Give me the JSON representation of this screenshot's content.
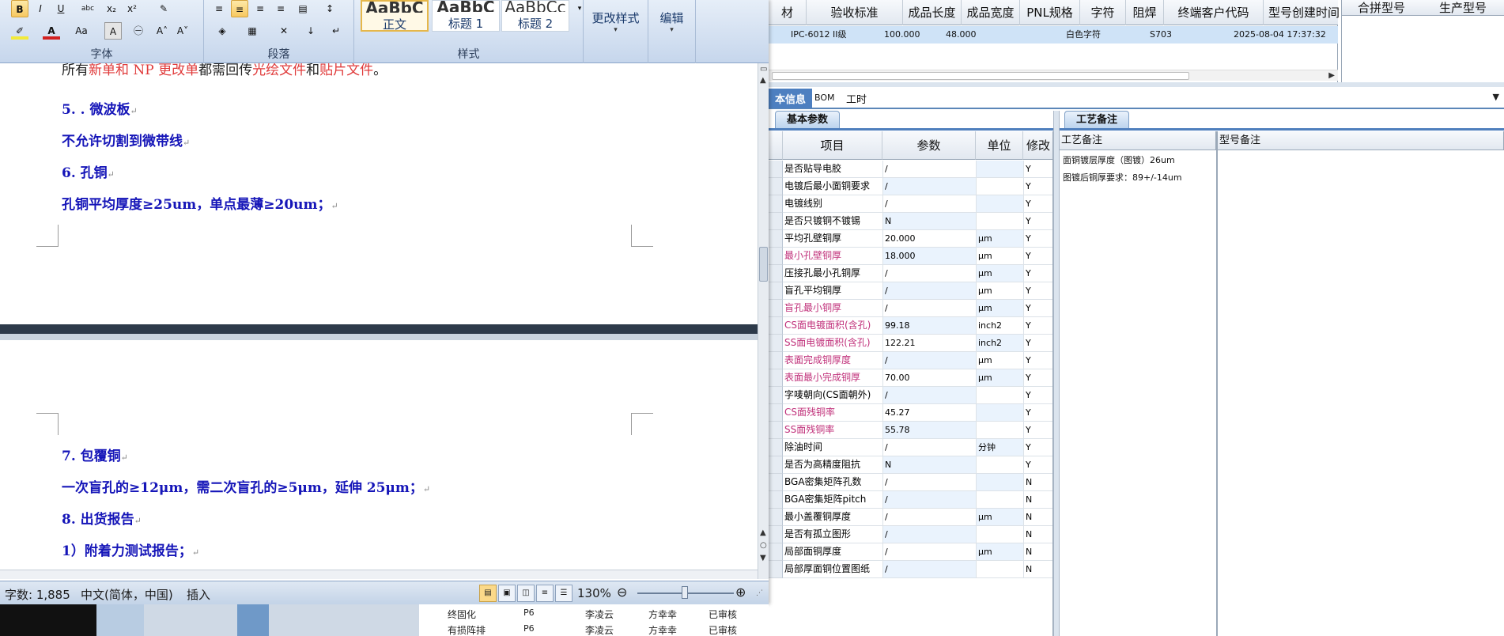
{
  "word": {
    "ribbon": {
      "groups": {
        "font": "字体",
        "paragraph": "段落",
        "styles": "样式"
      },
      "styles": [
        {
          "preview": "AaBbC",
          "name": "正文"
        },
        {
          "preview": "AaBbC",
          "name": "标题 1"
        },
        {
          "preview": "AaBbCc",
          "name": "标题 2"
        }
      ],
      "change_styles": "更改样式",
      "edit": "编辑",
      "font_color": "#d22020",
      "highlight_color": "#f2ea3a"
    },
    "doc": {
      "first_line": {
        "a": "所有",
        "b": "新单和 NP 更改单",
        "c": "都需回传",
        "d": "光绘文件",
        "e": "和",
        "f": "贴片文件",
        "g": "。"
      },
      "lines_top": [
        "5. . 微波板",
        "不允许切割到微带线",
        "6. 孔铜",
        "孔铜平均厚度≥25um，单点最薄≥20um；"
      ],
      "lines_bottom": [
        "7. 包覆铜",
        "一次盲孔的≥12μm，需二次盲孔的≥5μm，延伸 25μm；",
        "8. 出货报告",
        "1）附着力测试报告；"
      ]
    },
    "status": {
      "words": "字数: 1,885",
      "language": "中文(简体，中国)",
      "mode": "插入",
      "zoom": "130%"
    }
  },
  "app": {
    "top_columns": [
      "材",
      "验收标准",
      "成品长度",
      "成品宽度",
      "PNL规格",
      "字符",
      "阻焊",
      "终端客户代码",
      "型号创建时间"
    ],
    "top_row": [
      "",
      "IPC-6012 II级",
      "100.000",
      "48.000",
      "",
      "白色字符",
      "",
      "S703",
      "2025-08-04 17:37:32"
    ],
    "right_columns": [
      "合拼型号",
      "生产型号"
    ],
    "tabs": [
      "本信息",
      "BOM",
      "工时"
    ],
    "subtab_params": "基本参数",
    "subtab_craft": "工艺备注",
    "param_columns": [
      "项目",
      "参数",
      "单位",
      "修改"
    ],
    "params": [
      {
        "item": "是否贴导电胶",
        "value": "/",
        "unit": "",
        "mod": "Y",
        "pink": false
      },
      {
        "item": "电镀后最小面铜要求",
        "value": "/",
        "unit": "",
        "mod": "Y",
        "pink": false
      },
      {
        "item": "电镀线别",
        "value": "/",
        "unit": "",
        "mod": "Y",
        "pink": false
      },
      {
        "item": "是否只镀铜不镀锡",
        "value": "N",
        "unit": "",
        "mod": "Y",
        "pink": false
      },
      {
        "item": "平均孔壁铜厚",
        "value": "20.000",
        "unit": "μm",
        "mod": "Y",
        "pink": false
      },
      {
        "item": "最小孔壁铜厚",
        "value": "18.000",
        "unit": "μm",
        "mod": "Y",
        "pink": true
      },
      {
        "item": "压接孔最小孔铜厚",
        "value": "/",
        "unit": "μm",
        "mod": "Y",
        "pink": false
      },
      {
        "item": "盲孔平均铜厚",
        "value": "/",
        "unit": "μm",
        "mod": "Y",
        "pink": false
      },
      {
        "item": "盲孔最小铜厚",
        "value": "/",
        "unit": "μm",
        "mod": "Y",
        "pink": true
      },
      {
        "item": "CS面电镀面积(含孔)",
        "value": "99.18",
        "unit": "inch2",
        "mod": "Y",
        "pink": true
      },
      {
        "item": "SS面电镀面积(含孔)",
        "value": "122.21",
        "unit": "inch2",
        "mod": "Y",
        "pink": true
      },
      {
        "item": "表面完成铜厚度",
        "value": "/",
        "unit": "μm",
        "mod": "Y",
        "pink": true
      },
      {
        "item": "表面最小完成铜厚",
        "value": "70.00",
        "unit": "μm",
        "mod": "Y",
        "pink": true
      },
      {
        "item": "字唛朝向(CS面朝外)",
        "value": "/",
        "unit": "",
        "mod": "Y",
        "pink": false
      },
      {
        "item": "CS面残铜率",
        "value": "45.27",
        "unit": "",
        "mod": "Y",
        "pink": true
      },
      {
        "item": "SS面残铜率",
        "value": "55.78",
        "unit": "",
        "mod": "Y",
        "pink": true
      },
      {
        "item": "除油时间",
        "value": "/",
        "unit": "分钟",
        "mod": "Y",
        "pink": false
      },
      {
        "item": "是否为高精度阻抗",
        "value": "N",
        "unit": "",
        "mod": "Y",
        "pink": false
      },
      {
        "item": "BGA密集矩阵孔数",
        "value": "/",
        "unit": "",
        "mod": "N",
        "pink": false
      },
      {
        "item": "BGA密集矩阵pitch",
        "value": "/",
        "unit": "",
        "mod": "N",
        "pink": false
      },
      {
        "item": "最小盖覆铜厚度",
        "value": "/",
        "unit": "μm",
        "mod": "N",
        "pink": false
      },
      {
        "item": "是否有孤立图形",
        "value": "/",
        "unit": "",
        "mod": "N",
        "pink": false
      },
      {
        "item": "局部面铜厚度",
        "value": "/",
        "unit": "μm",
        "mod": "N",
        "pink": false
      },
      {
        "item": "局部厚面铜位置图纸",
        "value": "/",
        "unit": "",
        "mod": "N",
        "pink": false
      }
    ],
    "craft_columns": [
      "工艺备注",
      "型号备注"
    ],
    "craft_lines": [
      "面铜镀层厚度（图镀）26um",
      "图镀后铜厚要求：89+/-14um"
    ],
    "bottom_tree": [
      {
        "name": "终固化",
        "code": "P6",
        "p1": "李凌云",
        "p2": "方幸幸",
        "st": "已审核"
      },
      {
        "name": "有损阵排",
        "code": "P6",
        "p1": "李凌云",
        "p2": "方幸幸",
        "st": "已审核"
      }
    ]
  }
}
